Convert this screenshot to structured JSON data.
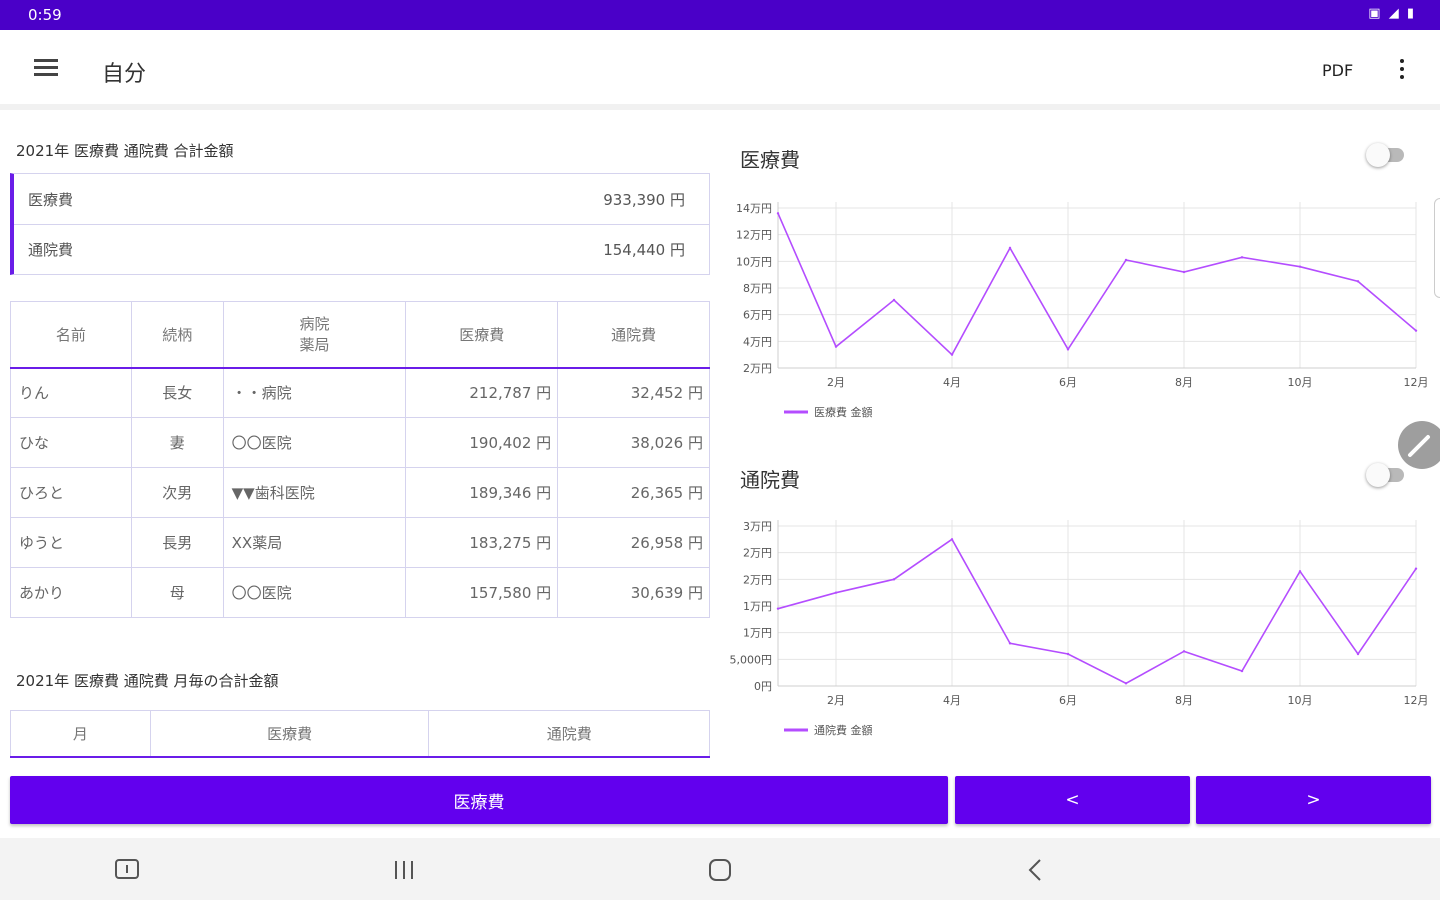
{
  "status_bar": {
    "time": "0:59",
    "indicators": "signal wifi battery"
  },
  "app_bar": {
    "title": "自分",
    "pdf_label": "PDF"
  },
  "summary": {
    "title": "2021年 医療費 通院費 合計金額",
    "rows": [
      {
        "label": "医療費",
        "amount": "933,390 円"
      },
      {
        "label": "通院費",
        "amount": "154,440 円"
      }
    ]
  },
  "members_table": {
    "headers": {
      "name": "名前",
      "relation": "続柄",
      "hospital_line1": "病院",
      "hospital_line2": "薬局",
      "medical": "医療費",
      "visit": "通院費"
    },
    "rows": [
      {
        "name": "りん",
        "relation": "長女",
        "hospital": "・・病院",
        "medical": "212,787 円",
        "visit": "32,452 円"
      },
      {
        "name": "ひな",
        "relation": "妻",
        "hospital": "〇〇医院",
        "medical": "190,402 円",
        "visit": "38,026 円"
      },
      {
        "name": "ひろと",
        "relation": "次男",
        "hospital": "▼▼歯科医院",
        "medical": "189,346 円",
        "visit": "26,365 円"
      },
      {
        "name": "ゆうと",
        "relation": "長男",
        "hospital": "XX薬局",
        "medical": "183,275 円",
        "visit": "26,958 円"
      },
      {
        "name": "あかり",
        "relation": "母",
        "hospital": "〇〇医院",
        "medical": "157,580 円",
        "visit": "30,639 円"
      }
    ]
  },
  "monthly": {
    "title": "2021年 医療費 通院費 月毎の合計金額",
    "headers": {
      "month": "月",
      "medical": "医療費",
      "visit": "通院費"
    }
  },
  "charts": {
    "medical_title": "医療費",
    "visit_title": "通院費"
  },
  "chart_data": [
    {
      "type": "line",
      "title": "医療費",
      "x": [
        1,
        2,
        3,
        4,
        5,
        6,
        7,
        8,
        9,
        10,
        11,
        12
      ],
      "x_tick_labels": [
        "2月",
        "4月",
        "6月",
        "8月",
        "10月",
        "12月"
      ],
      "y_tick_labels": [
        "2万円",
        "4万円",
        "6万円",
        "8万円",
        "10万円",
        "12万円",
        "14万円"
      ],
      "ylim": [
        20000,
        140000
      ],
      "series": [
        {
          "name": "医療費 金額",
          "color": "#b44dff",
          "values": [
            136000,
            36000,
            71000,
            30000,
            110000,
            34000,
            101000,
            92000,
            103000,
            96000,
            85000,
            48000
          ]
        }
      ],
      "legend": "bottom-left",
      "grid": true
    },
    {
      "type": "line",
      "title": "通院費",
      "x": [
        1,
        2,
        3,
        4,
        5,
        6,
        7,
        8,
        9,
        10,
        11,
        12
      ],
      "x_tick_labels": [
        "2月",
        "4月",
        "6月",
        "8月",
        "10月",
        "12月"
      ],
      "y_tick_labels": [
        "0円",
        "5,000円",
        "1万円",
        "1万円",
        "2万円",
        "2万円",
        "3万円"
      ],
      "ylim": [
        0,
        30000
      ],
      "series": [
        {
          "name": "通院費 金額",
          "color": "#b44dff",
          "values": [
            14500,
            17500,
            20000,
            27500,
            8000,
            6000,
            500,
            6500,
            2800,
            21500,
            6000,
            22000
          ]
        }
      ],
      "legend": "bottom-left",
      "grid": true
    }
  ],
  "bottom_buttons": {
    "category": "医療費",
    "prev": "<",
    "next": ">"
  },
  "colors": {
    "primary": "#6200ee",
    "status_bar": "#4a00c8",
    "accent_line": "#b44dff"
  }
}
